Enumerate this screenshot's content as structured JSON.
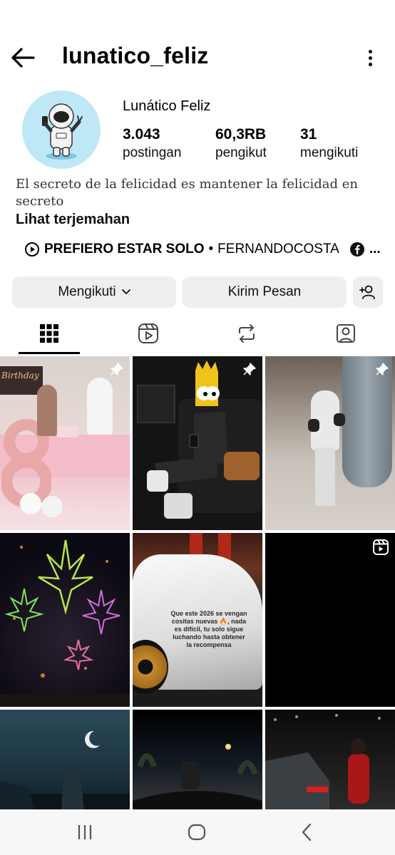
{
  "header": {
    "username": "lunatico_feliz"
  },
  "profile": {
    "display_name": "Lunático Feliz",
    "stats": [
      {
        "value": "3.043",
        "label": "postingan"
      },
      {
        "value": "60,3RB",
        "label": "pengikut"
      },
      {
        "value": "31",
        "label": "mengikuti"
      }
    ],
    "bio": "El secreto de la felicidad es mantener la felicidad en secreto",
    "see_translation": "Lihat terjemahan",
    "music": {
      "song": "PREFIERO ESTAR SOLO",
      "separator": "•",
      "artist": "FERNANDOCOSTA",
      "more": "..."
    }
  },
  "actions": {
    "following_label": "Mengikuti",
    "message_label": "Kirim Pesan"
  },
  "tabs": [
    {
      "icon": "grid-icon",
      "selected": true
    },
    {
      "icon": "reels-icon",
      "selected": false
    },
    {
      "icon": "reposts-icon",
      "selected": false
    },
    {
      "icon": "tagged-icon",
      "selected": false
    }
  ],
  "posts": {
    "tile_5_caption": "Que este 2026 se vengan cositas nuevas 🔥, nada es difícil, tu solo sigue luchando hasta obtener la recompensa",
    "tile_1_text": "Birthday",
    "pinned_count": 3
  },
  "colors": {
    "accent_button": "#efeff1",
    "avatar_bg": "#bfe8f6"
  }
}
